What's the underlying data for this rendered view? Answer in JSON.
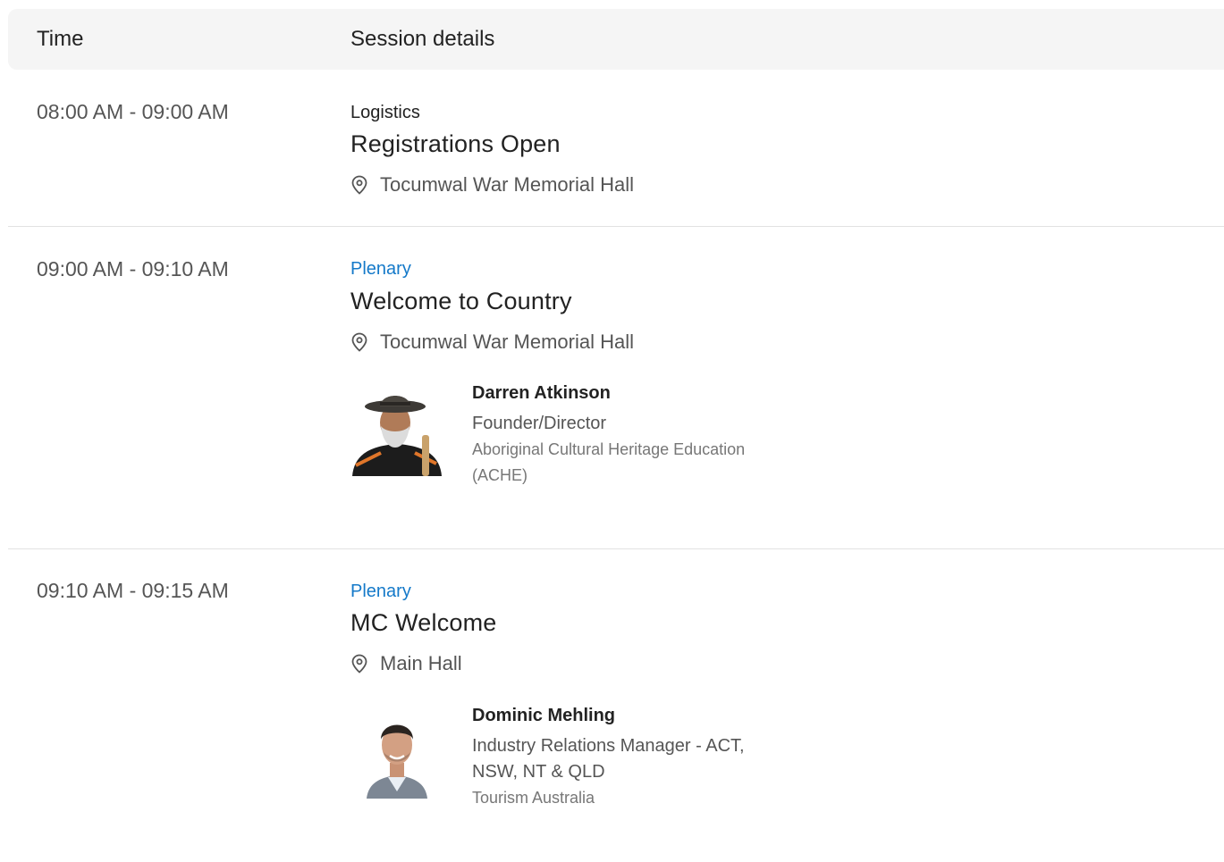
{
  "header": {
    "time_label": "Time",
    "details_label": "Session details"
  },
  "sessions": [
    {
      "time": "08:00 AM - 09:00 AM",
      "category": "Logistics",
      "title": "Registrations Open",
      "location": "Tocumwal War Memorial Hall"
    },
    {
      "time": "09:00 AM - 09:10 AM",
      "category": "Plenary",
      "title": "Welcome to Country",
      "location": "Tocumwal War Memorial Hall",
      "speaker": {
        "name": "Darren Atkinson",
        "role": "Founder/Director",
        "org_line1": "Aboriginal Cultural Heritage Education",
        "org_line2": "(ACHE)"
      }
    },
    {
      "time": "09:10 AM - 09:15 AM",
      "category": "Plenary",
      "title": "MC Welcome",
      "location": "Main Hall",
      "speaker": {
        "name": "Dominic Mehling",
        "role_line1": "Industry Relations Manager - ACT,",
        "role_line2": "NSW, NT & QLD",
        "org": "Tourism Australia"
      }
    }
  ],
  "colors": {
    "accent": "#1479c9",
    "header_bg": "#f5f5f5",
    "divider": "#e2e2e2"
  },
  "icons": {
    "location": "map-pin-icon"
  }
}
